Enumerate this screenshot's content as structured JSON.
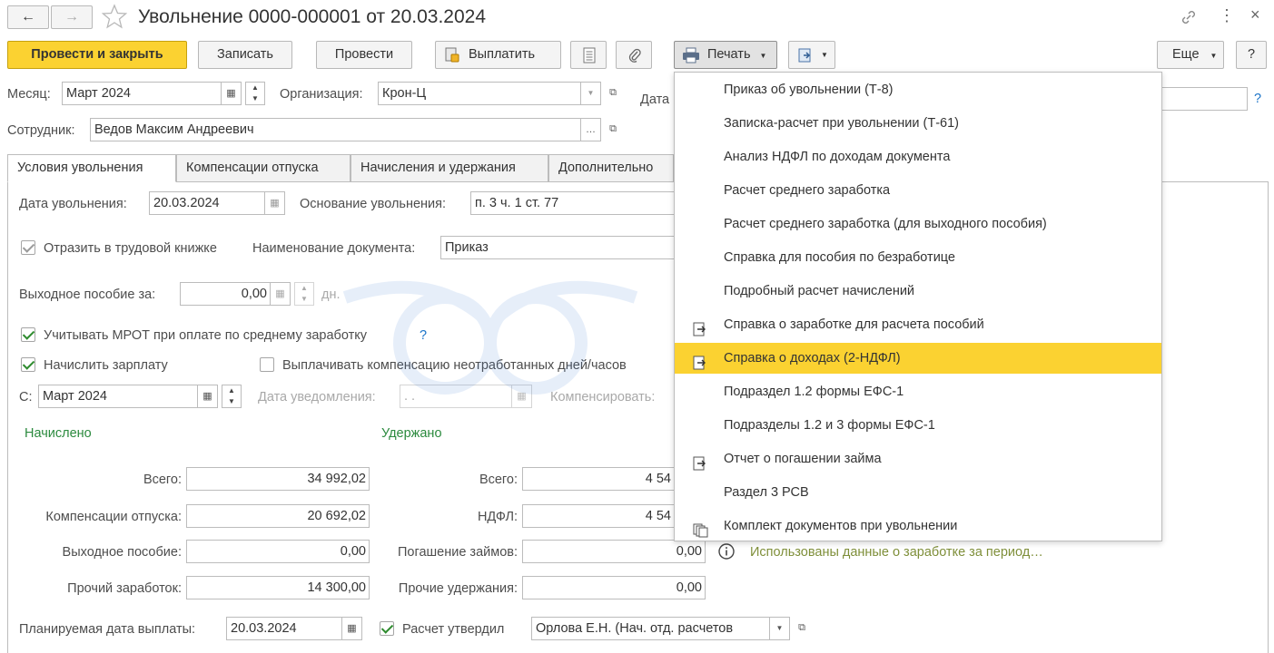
{
  "window": {
    "title": "Увольнение 0000-000001 от 20.03.2024",
    "close_glyph": "×",
    "more_glyph": "⋮"
  },
  "toolbar": {
    "post_close": "Провести и закрыть",
    "save": "Записать",
    "post": "Провести",
    "pay": "Выплатить",
    "print": "Печать",
    "more": "Еще",
    "help": "?"
  },
  "header": {
    "month_label": "Месяц:",
    "month_value": "Март 2024",
    "org_label": "Организация:",
    "org_value": "Крон-Ц",
    "date_label": "Дата",
    "help_mark": "?",
    "employee_label": "Сотрудник:",
    "employee_value": "Ведов Максим Андреевич"
  },
  "tabs": [
    {
      "label": "Условия увольнения"
    },
    {
      "label": "Компенсации отпуска"
    },
    {
      "label": "Начисления и удержания"
    },
    {
      "label": "Дополнительно"
    }
  ],
  "conditions": {
    "dismissal_date_label": "Дата увольнения:",
    "dismissal_date_value": "20.03.2024",
    "basis_label": "Основание увольнения:",
    "basis_value": "п. 3 ч. 1 ст. 77",
    "record_book_label": "Отразить в трудовой книжке",
    "doc_name_label": "Наименование документа:",
    "doc_name_value": "Приказ",
    "severance_label": "Выходное пособие за:",
    "severance_value": "0,00",
    "severance_unit": "дн.",
    "mrot_label": "Учитывать МРОТ при оплате по среднему заработку",
    "mrot_help": "?",
    "accrue_salary_label": "Начислить зарплату",
    "pay_comp_label": "Выплачивать компенсацию неотработанных дней/часов",
    "from_label": "С:",
    "from_value": "Март 2024",
    "notice_date_label": "Дата уведомления:",
    "notice_date_value": " .  .",
    "compensate_label": "Компенсировать:"
  },
  "accrued": {
    "title": "Начислено",
    "rows": [
      {
        "label": "Всего:",
        "value": "34 992,02"
      },
      {
        "label": "Компенсации отпуска:",
        "value": "20 692,02"
      },
      {
        "label": "Выходное пособие:",
        "value": "0,00"
      },
      {
        "label": "Прочий заработок:",
        "value": "14 300,00"
      }
    ]
  },
  "withheld": {
    "title": "Удержано",
    "rows": [
      {
        "label": "Всего:",
        "value": "4 54"
      },
      {
        "label": "НДФЛ:",
        "value": "4 54"
      },
      {
        "label": "Погашение займов:",
        "value": "0,00"
      },
      {
        "label": "Прочие удержания:",
        "value": "0,00"
      }
    ]
  },
  "earnings_note": "Использованы данные о заработке за период…",
  "footer": {
    "planned_date_label": "Планируемая дата выплаты:",
    "planned_date_value": "20.03.2024",
    "approved_label": "Расчет утвердил",
    "approved_value": "Орлова Е.Н. (Нач. отд. расчетов"
  },
  "print_menu": {
    "items": [
      {
        "label": "Приказ об увольнении (Т-8)",
        "icon": "none"
      },
      {
        "label": "Записка-расчет при увольнении (Т-61)",
        "icon": "none"
      },
      {
        "label": "Анализ НДФЛ по доходам документа",
        "icon": "none"
      },
      {
        "label": "Расчет среднего заработка",
        "icon": "none"
      },
      {
        "label": "Расчет среднего заработка (для выходного пособия)",
        "icon": "none"
      },
      {
        "label": "Справка для пособия по безработице",
        "icon": "none"
      },
      {
        "label": "Подробный расчет начислений",
        "icon": "none"
      },
      {
        "label": "Справка о заработке для расчета пособий",
        "icon": "document-export-icon"
      },
      {
        "label": "Справка о доходах (2-НДФЛ)",
        "icon": "document-export-icon",
        "highlighted": true
      },
      {
        "label": "Подраздел 1.2 формы ЕФС-1",
        "icon": "none"
      },
      {
        "label": "Подразделы 1.2 и 3 формы ЕФС-1",
        "icon": "none"
      },
      {
        "label": "Отчет о погашении займа",
        "icon": "document-export-icon"
      },
      {
        "label": "Раздел 3 РСВ",
        "icon": "none"
      },
      {
        "label": "Комплект документов при увольнении",
        "icon": "documents-set-icon"
      }
    ]
  },
  "colors": {
    "primary_button": "#fbd231",
    "highlight": "#fbd231",
    "section_title": "#2b8a3e",
    "link": "#1a73c8"
  }
}
